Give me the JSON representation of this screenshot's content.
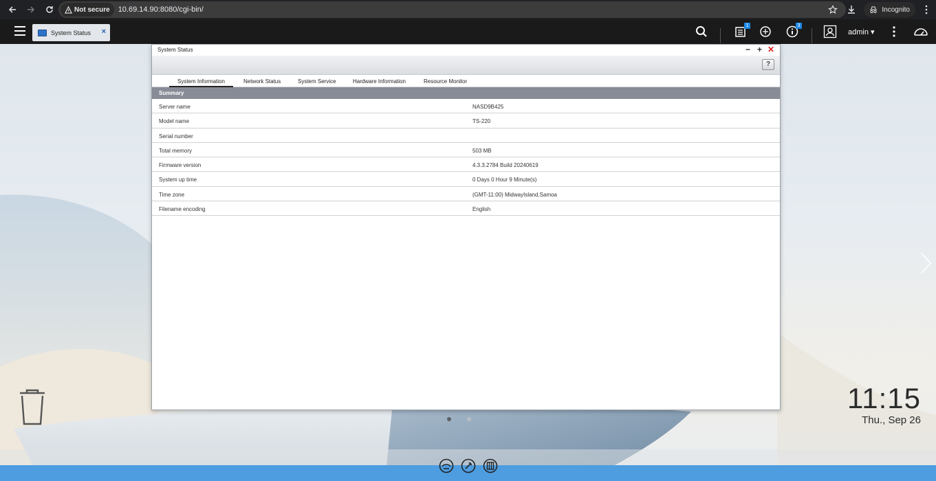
{
  "browser": {
    "security_label": "Not secure",
    "url": "10.69.14.90:8080/cgi-bin/",
    "incognito_label": "Incognito"
  },
  "qts": {
    "app_tab_label": "System Status",
    "tab_close": "×",
    "notif_badge_1": "1",
    "notif_badge_2": "3",
    "user": "admin ▾"
  },
  "window": {
    "title": "System Status",
    "help": "?",
    "tabs": [
      "System Information",
      "Network Status",
      "System Service",
      "Hardware Information",
      "Resource Monitor"
    ],
    "section": "Summary",
    "rows": [
      {
        "label": "Server name",
        "value": "NASD9B425"
      },
      {
        "label": "Model name",
        "value": "TS-220"
      },
      {
        "label": "Serial number",
        "value": ""
      },
      {
        "label": "Total memory",
        "value": "503 MB"
      },
      {
        "label": "Firmware version",
        "value": "4.3.3.2784 Build 20240619"
      },
      {
        "label": "System up time",
        "value": "0 Days 0 Hour 9 Minute(s)"
      },
      {
        "label": "Time zone",
        "value": "(GMT-11:00) MidwayIsland,Samoa"
      },
      {
        "label": "Filename encoding",
        "value": "English"
      }
    ]
  },
  "desktop": {
    "clock_time": "11:15",
    "clock_date": "Thu., Sep 26"
  },
  "colors": {
    "accent_blue": "#4d9de0",
    "close_red": "#e02020",
    "summary_header": "#888c96"
  }
}
